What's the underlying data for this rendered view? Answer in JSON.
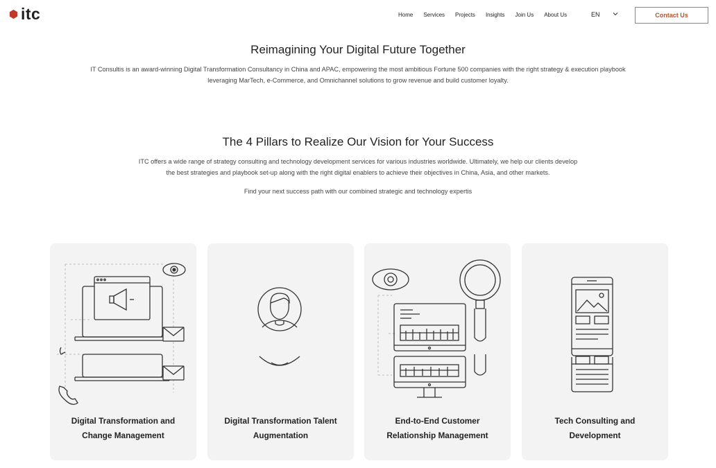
{
  "header": {
    "logo_text": "itc",
    "nav": [
      "Home",
      "Services",
      "Projects",
      "Insights",
      "Join Us",
      "About Us"
    ],
    "language": "EN",
    "contact_label": "Contact Us",
    "accent_color": "#b5532d"
  },
  "hero": {
    "title": "Reimagining Your Digital Future Together",
    "description_lines": [
      "IT Consultis is an award-winning Digital Transformation Consultancy in China and APAC, empowering the most ambitious Fortune 500 companies with the right strategy & execution playbook",
      "leveraging MarTech, e-Commerce, and Omnichannel solutions to grow revenue and build customer loyalty."
    ]
  },
  "pillars": {
    "title": "The 4 Pillars to Realize Our Vision for Your Success",
    "description_lines": [
      "ITC offers a wide range of strategy consulting and technology development services for various industries worldwide. Ultimately, we help our clients develop",
      "the best strategies and playbook set-up along with the right digital enablers to achieve their objectives in China, Asia, and other markets."
    ],
    "tagline": "Find your next success path with our combined strategic and technology expertis",
    "cards": [
      {
        "title_lines": [
          "Digital Transformation and",
          "Change Management"
        ],
        "icon": "laptop-megaphone-icon"
      },
      {
        "title_lines": [
          "Digital Transformation Talent",
          "Augmentation"
        ],
        "icon": "person-avatar-icon"
      },
      {
        "title_lines": [
          "End-to-End Customer",
          "Relationship Management"
        ],
        "icon": "monitor-magnifier-icon"
      },
      {
        "title_lines": [
          "Tech Consulting and",
          "Development"
        ],
        "icon": "mobile-app-icon"
      }
    ]
  }
}
